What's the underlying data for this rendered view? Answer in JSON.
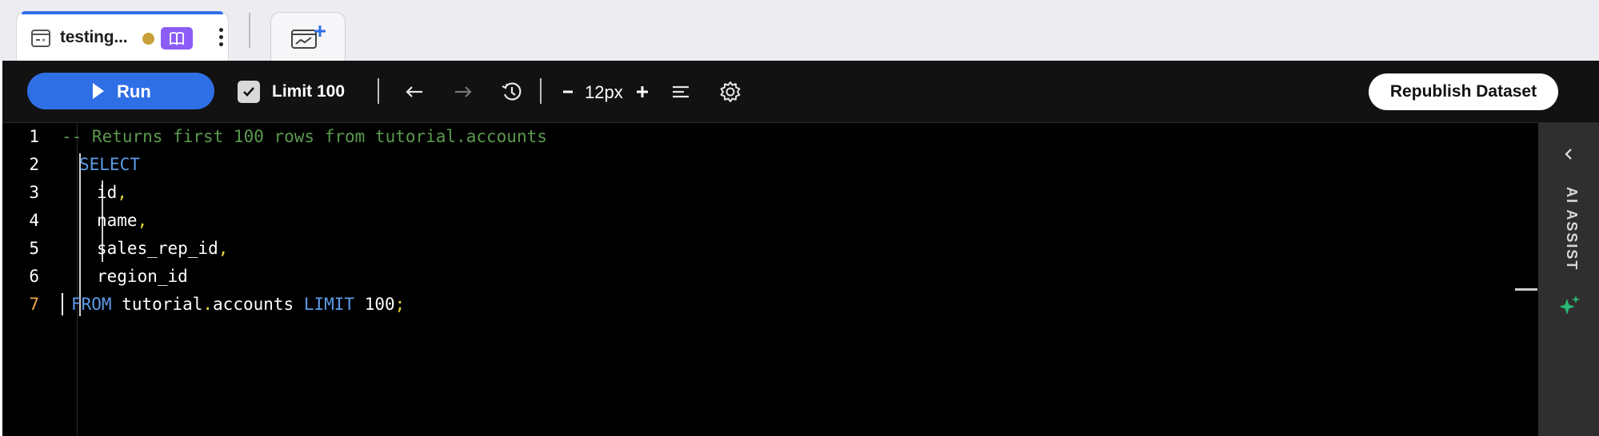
{
  "tabs": {
    "active": {
      "title": "testing..."
    },
    "new_tab_label": ""
  },
  "toolbar": {
    "run_label": "Run",
    "limit_label": "Limit 100",
    "limit_checked": true,
    "font_size": "12px",
    "republish_label": "Republish Dataset"
  },
  "editor": {
    "line_numbers": [
      "1",
      "2",
      "3",
      "4",
      "5",
      "6",
      "7"
    ],
    "active_line": "7",
    "lines": [
      {
        "tokens": [
          {
            "t": "-- Returns first 100 rows from tutorial.accounts",
            "c": "cmt"
          }
        ]
      },
      {
        "tokens": [
          {
            "t": "SELECT",
            "c": "kw"
          }
        ]
      },
      {
        "tokens": [
          {
            "t": "id",
            "c": ""
          },
          {
            "t": ",",
            "c": "pn"
          }
        ]
      },
      {
        "tokens": [
          {
            "t": "name",
            "c": ""
          },
          {
            "t": ",",
            "c": "pn"
          }
        ]
      },
      {
        "tokens": [
          {
            "t": "sales_rep_id",
            "c": ""
          },
          {
            "t": ",",
            "c": "pn"
          }
        ]
      },
      {
        "tokens": [
          {
            "t": "region_id",
            "c": ""
          }
        ]
      },
      {
        "tokens": [
          {
            "t": "FROM",
            "c": "kw"
          },
          {
            "t": " tutorial",
            "c": ""
          },
          {
            "t": ".",
            "c": "pn"
          },
          {
            "t": "accounts ",
            "c": ""
          },
          {
            "t": "LIMIT",
            "c": "kw"
          },
          {
            "t": " 100",
            "c": ""
          },
          {
            "t": ";",
            "c": "pn"
          }
        ]
      }
    ]
  },
  "ai_assist": {
    "label": "AI ASSIST"
  },
  "colors": {
    "accent": "#2f6fe6",
    "editor_bg": "#000000",
    "keyword": "#5c9be8",
    "comment": "#5a9a4e",
    "punctuation": "#e7d43c",
    "active_line_number": "#f0a84a",
    "tab_dot": "#c9a13a",
    "tab_badge": "#8b5cf6",
    "ai_spark": "#2bb673"
  },
  "icons": [
    "dataset-icon",
    "book-icon",
    "kebab-icon",
    "new-chart-icon",
    "play-icon",
    "checkbox-icon",
    "undo-arrow-icon",
    "redo-arrow-icon",
    "history-icon",
    "minus-icon",
    "plus-icon",
    "format-icon",
    "gear-icon",
    "chevron-left-icon",
    "sparkle-icon"
  ]
}
